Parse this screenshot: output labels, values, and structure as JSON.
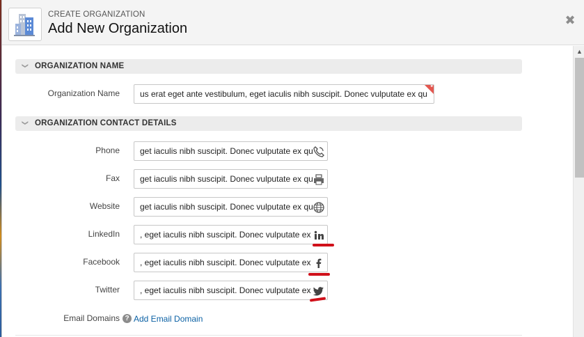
{
  "header": {
    "subtitle": "CREATE ORGANIZATION",
    "title": "Add New Organization",
    "close_glyph": "✖",
    "icon": "building-icon"
  },
  "sections": {
    "org_name": {
      "label": "ORGANIZATION NAME",
      "chevron": "❯"
    },
    "contact": {
      "label": "ORGANIZATION CONTACT DETAILS",
      "chevron": "❯"
    }
  },
  "fields": {
    "organization_name": {
      "label": "Organization Name",
      "value": "us erat eget ante vestibulum, eget iaculis nibh suscipit. Donec vulputate ex qu",
      "required_marker": "*"
    },
    "phone": {
      "label": "Phone",
      "value": "get iaculis nibh suscipit. Donec vulputate ex qu",
      "icon": "phone-icon"
    },
    "fax": {
      "label": "Fax",
      "value": "get iaculis nibh suscipit. Donec vulputate ex qu",
      "icon": "fax-icon"
    },
    "website": {
      "label": "Website",
      "value": "get iaculis nibh suscipit. Donec vulputate ex qu",
      "icon": "globe-icon"
    },
    "linkedin": {
      "label": "LinkedIn",
      "value": ", eget iaculis nibh suscipit. Donec vulputate ex qu",
      "icon": "linkedin-icon"
    },
    "facebook": {
      "label": "Facebook",
      "value": ", eget iaculis nibh suscipit. Donec vulputate ex qu",
      "icon": "facebook-icon"
    },
    "twitter": {
      "label": "Twitter",
      "value": ", eget iaculis nibh suscipit. Donec vulputate ex qu",
      "icon": "twitter-icon"
    }
  },
  "email_domains": {
    "label": "Email Domains",
    "help_glyph": "?",
    "link": "Add Email Domain"
  },
  "scrollbar": {
    "up_glyph": "▲"
  },
  "colors": {
    "accent_link": "#0b61a4",
    "required": "#e4574f",
    "annotation": "#d0101a"
  }
}
